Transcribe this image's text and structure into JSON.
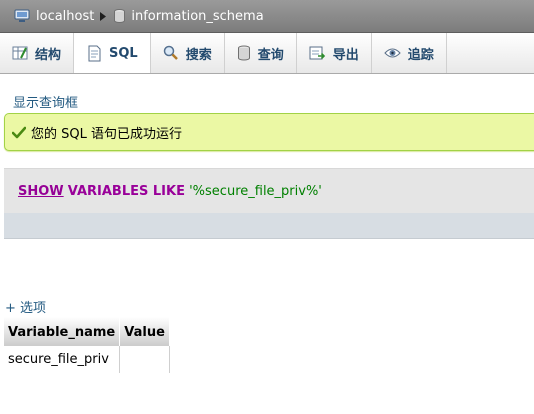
{
  "breadcrumb": {
    "server": "localhost",
    "database": "information_schema"
  },
  "tabs": [
    {
      "label": "结构",
      "icon": "structure-icon"
    },
    {
      "label": "SQL",
      "icon": "sql-icon"
    },
    {
      "label": "搜索",
      "icon": "search-icon"
    },
    {
      "label": "查询",
      "icon": "query-icon"
    },
    {
      "label": "导出",
      "icon": "export-icon"
    },
    {
      "label": "追踪",
      "icon": "tracking-icon"
    }
  ],
  "show_query_link": "显示查询框",
  "success_message": "您的 SQL 语句已成功运行",
  "sql": {
    "keyword_show": "SHOW",
    "keywords_rest": "VARIABLES LIKE",
    "pattern": "'%secure_file_priv%'"
  },
  "options_link": "+ 选项",
  "results": {
    "columns": [
      "Variable_name",
      "Value"
    ],
    "rows": [
      [
        "secure_file_priv",
        ""
      ]
    ]
  },
  "colors": {
    "success_bg": "#ebf8a4",
    "success_border": "#a2d246",
    "link": "#235a81",
    "keyword": "#990099",
    "string": "#008000"
  }
}
